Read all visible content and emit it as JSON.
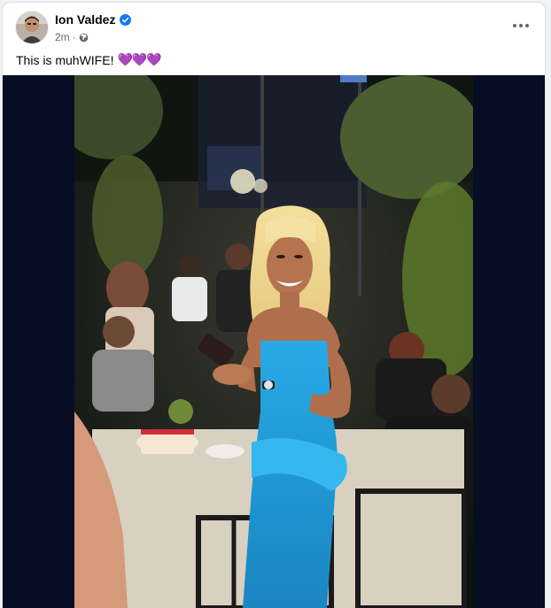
{
  "post": {
    "author": {
      "name": "Ion Valdez",
      "verified": true,
      "verified_icon": "verified-badge-icon",
      "avatar_icon": "avatar-photo"
    },
    "timestamp": "2m",
    "separator": "·",
    "audience_icon": "globe-icon",
    "menu_icon": "more-options-icon",
    "caption": {
      "text": "This is muhWIFE!",
      "emoji": "💜💜💜"
    },
    "media": {
      "type": "photo",
      "description_icon": "post-photo"
    }
  },
  "colors": {
    "accent": "#1877f2",
    "text_primary": "#050505",
    "text_secondary": "#65676b",
    "media_background": "#070d24",
    "dress": "#1d9ad6",
    "heart": "#8e44ff"
  }
}
